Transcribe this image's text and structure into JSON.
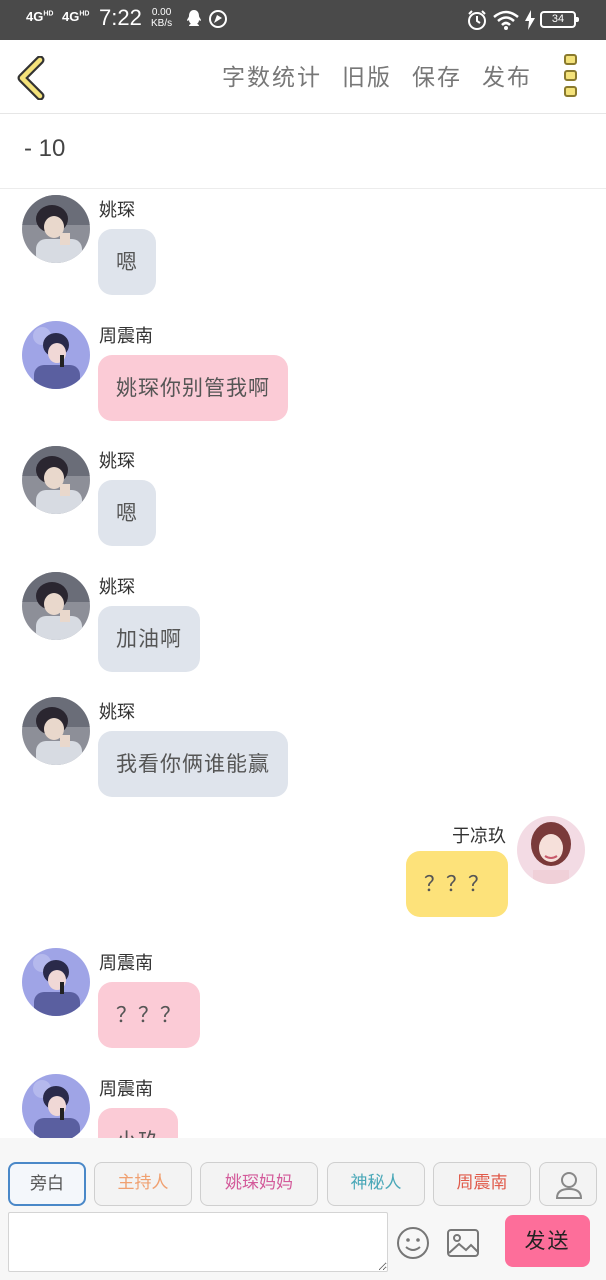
{
  "status_bar": {
    "net1": "4G",
    "net1_sup": "HD",
    "net2": "4G",
    "net2_sup": "HD",
    "time": "7:22",
    "speed_value": "0.00",
    "speed_unit": "KB/s",
    "battery": "34"
  },
  "toolbar": {
    "word_count": "字数统计",
    "old_version": "旧版",
    "save": "保存",
    "publish": "发布"
  },
  "title": "- 10",
  "messages": [
    {
      "sender": "姚琛",
      "text": "嗯",
      "side": "left",
      "bubble": "gray",
      "avatar": "yao-chen"
    },
    {
      "sender": "周震南",
      "text": "姚琛你别管我啊",
      "side": "left",
      "bubble": "pink",
      "avatar": "zhou-zhennan"
    },
    {
      "sender": "姚琛",
      "text": "嗯",
      "side": "left",
      "bubble": "gray",
      "avatar": "yao-chen"
    },
    {
      "sender": "姚琛",
      "text": "加油啊",
      "side": "left",
      "bubble": "gray",
      "avatar": "yao-chen"
    },
    {
      "sender": "姚琛",
      "text": "我看你俩谁能赢",
      "side": "left",
      "bubble": "gray",
      "avatar": "yao-chen"
    },
    {
      "sender": "于凉玖",
      "text": "？？？",
      "side": "right",
      "bubble": "yellow",
      "avatar": "yu-liangjiu"
    },
    {
      "sender": "周震南",
      "text": "？？？",
      "side": "left",
      "bubble": "pink",
      "avatar": "zhou-zhennan"
    },
    {
      "sender": "周震南",
      "text": "小玖",
      "side": "left",
      "bubble": "pink",
      "avatar": "zhou-zhennan"
    }
  ],
  "roles": [
    {
      "label": "旁白",
      "color": "#555555",
      "active": true
    },
    {
      "label": "主持人",
      "color": "#f0a070"
    },
    {
      "label": "姚琛妈妈",
      "color": "#d35a9a"
    },
    {
      "label": "神秘人",
      "color": "#4aa8b8"
    },
    {
      "label": "周震南",
      "color": "#e05a4a"
    }
  ],
  "input": {
    "placeholder": "",
    "value": ""
  },
  "send_label": "发送",
  "colors": {
    "bubble_gray": "#dfe4ec",
    "bubble_pink": "#fbcbd6",
    "bubble_yellow": "#fde27a",
    "send_button": "#fd6e9a",
    "status_bar": "#4a4a4a"
  }
}
